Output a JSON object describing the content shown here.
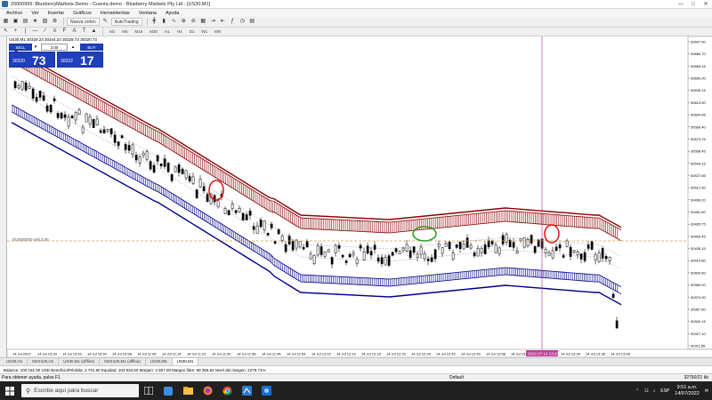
{
  "window": {
    "title": "20000965: BlueberryMarkets-Demo - Cuenta demo - Blueberry Markets Pty Ltd - [US30,M1]",
    "minimize": "—",
    "maximize": "□",
    "close": "✕"
  },
  "menu": {
    "items": [
      "Archivo",
      "Ver",
      "Insertar",
      "Gráficos",
      "Herramientas",
      "Ventana",
      "Ayuda"
    ]
  },
  "toolbar": {
    "new_order": "Nueva orden",
    "autotrading": "AutoTrading"
  },
  "timeframes": [
    "M1",
    "M5",
    "M15",
    "M30",
    "H1",
    "H4",
    "D1",
    "W1",
    "MN"
  ],
  "chart": {
    "symbol_info": "US30,M1  30329.23 30344.23 30329.73 30320.73",
    "trade_panel": {
      "sell_label": "SELL",
      "buy_label": "BUY",
      "lot": "3.00",
      "sell_small": "30320",
      "sell_big": "73",
      "buy_small": "30322",
      "buy_big": "17"
    },
    "level_label": "#10000000 sell 3.00",
    "crosshair_time": "2022.07.14 13:29",
    "price_axis": [
      "30697.50",
      "30680.70",
      "30665.15",
      "30650.90",
      "30635.15",
      "30619.90",
      "30604.65",
      "30589.40",
      "30573.75",
      "30558.45",
      "30543.15",
      "30527.85",
      "30512.50",
      "30496.20",
      "30481.50",
      "30465.75",
      "30450.45",
      "30435.15",
      "30419.80",
      "30404.50",
      "30389.20",
      "30373.90",
      "30357.60",
      "30342.15",
      "30327.10",
      "30311.85"
    ],
    "time_axis": [
      "14 Jul 2022",
      "14 Jul 10:34",
      "14 Jul 10:42",
      "14 Jul 10:50",
      "14 Jul 10:58",
      "14 Jul 11:06",
      "14 Jul 11:14",
      "14 Jul 11:22",
      "14 Jul 11:30",
      "14 Jul 11:38",
      "14 Jul 11:46",
      "14 Jul 11:54",
      "14 Jul 12:02",
      "14 Jul 12:10",
      "14 Jul 12:18",
      "14 Jul 12:26",
      "14 Jul 12:34",
      "14 Jul 12:42",
      "14 Jul 12:50",
      "14 Jul 12:58",
      "14 Jul 13:06",
      "14 Jul 13:14",
      "14 Jul 13:30",
      "14 Jul 13:38",
      "14 Jul 13:46"
    ],
    "colors": {
      "upper_band": "#8b0000",
      "lower_band": "#00008b",
      "candle_up": "#ffffff",
      "candle_down": "#000000",
      "level_line": "#c8a050",
      "crosshair": "#c0409a",
      "circle_red": "#e01010",
      "circle_green": "#20a020"
    }
  },
  "tabs": [
    "US30,H1",
    "NDX100,H1",
    "US30,M1 (offline)",
    "NDX100,M1 (offline)",
    "US30,M5",
    "US30,M1"
  ],
  "balance_text": "Balance: 100 181.80 USD  Beneficio/Pérdida: 3 751.80  Equidad: 103 933.60  Margen: 4 567.08  Margen libre: 99 366.52  Nivel del margen: 2275.71%",
  "status": {
    "help": "Para obtener ayuda, pulse F1",
    "profile": "Default",
    "connection": "32790/21 kb"
  },
  "taskbar": {
    "search_placeholder": "Escribe aquí para buscar",
    "time": "9:51 a.m.",
    "date": "14/07/2022",
    "lang": "ESP"
  }
}
